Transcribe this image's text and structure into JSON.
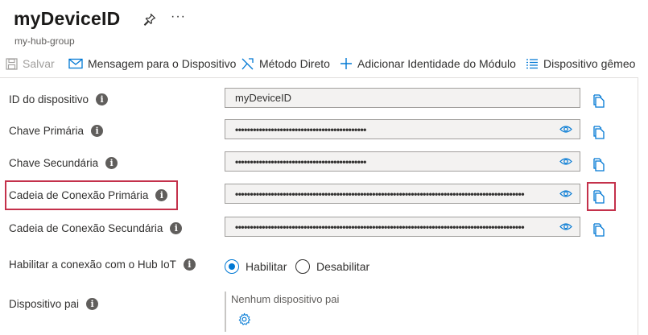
{
  "header": {
    "title": "myDeviceID",
    "subtitle": "my-hub-group",
    "more": "···"
  },
  "toolbar": {
    "save": "Salvar",
    "message": "Mensagem para o Dispositivo",
    "direct_method": "Método Direto",
    "add_module": "Adicionar Identidade do Módulo",
    "twin": "Dispositivo gêmeo"
  },
  "fields": {
    "device_id": {
      "label": "ID do dispositivo",
      "value": "myDeviceID"
    },
    "primary_key": {
      "label": "Chave Primária",
      "value": "••••••••••••••••••••••••••••••••••••••••••••"
    },
    "secondary_key": {
      "label": "Chave Secundária",
      "value": "••••••••••••••••••••••••••••••••••••••••••••"
    },
    "primary_conn": {
      "label": "Cadeia de Conexão Primária",
      "value": "•••••••••••••••••••••••••••••••••••••••••••••••••••••••••••••••••••••••••••••••••••••••••••••••••"
    },
    "secondary_conn": {
      "label": "Cadeia de Conexão Secundária",
      "value": "•••••••••••••••••••••••••••••••••••••••••••••••••••••••••••••••••••••••••••••••••••••••••••••••••"
    }
  },
  "hub_connection": {
    "label": "Habilitar a conexão com o Hub IoT",
    "enable": "Habilitar",
    "disable": "Desabilitar",
    "selected": "Habilitar"
  },
  "parent_device": {
    "label": "Dispositivo pai",
    "value": "Nenhum dispositivo pai"
  },
  "info_glyph": "i",
  "colors": {
    "accent": "#0078d4",
    "highlight": "#c4314b",
    "field_bg": "#f3f2f1"
  },
  "icons": [
    "pin-icon",
    "save-icon",
    "mail-icon",
    "direct-method-icon",
    "plus-icon",
    "list-icon",
    "info-icon",
    "eye-icon",
    "copy-icon",
    "gear-icon"
  ]
}
